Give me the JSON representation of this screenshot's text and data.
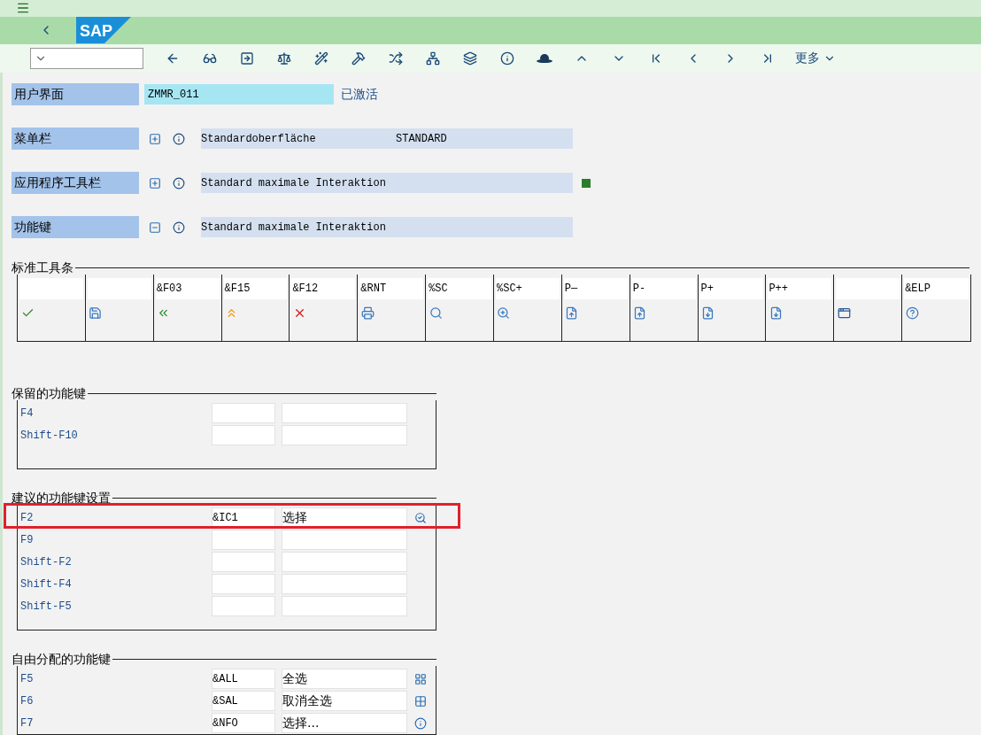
{
  "logo": "SAP",
  "toolbar": {
    "more": "更多"
  },
  "header_rows": [
    {
      "kind": "interface",
      "label": "用户界面",
      "value": "ZMMR_011",
      "status": "已激活"
    },
    {
      "kind": "element",
      "label": "菜单栏",
      "description": "Standardoberfläche",
      "code": "STANDARD",
      "marked": false
    },
    {
      "kind": "element",
      "label": "应用程序工具栏",
      "description": "Standard maximale Interaktion",
      "marked": true
    },
    {
      "kind": "element",
      "label": "功能键",
      "description": "Standard maximale Interaktion",
      "marked": false
    }
  ],
  "standard_toolbar": {
    "title": "标准工具条",
    "cells": [
      {
        "kind": "check"
      },
      {
        "kind": "save"
      },
      {
        "code": "&F03",
        "kind": "back"
      },
      {
        "code": "&F15",
        "kind": "exit"
      },
      {
        "code": "&F12",
        "kind": "cancel"
      },
      {
        "code": "&RNT",
        "kind": "print"
      },
      {
        "code": "%SC",
        "kind": "find"
      },
      {
        "code": "%SC+",
        "kind": "find-next"
      },
      {
        "code": "P—",
        "kind": "first-page"
      },
      {
        "code": "P-",
        "kind": "prev-page"
      },
      {
        "code": "P+",
        "kind": "next-page"
      },
      {
        "code": "P++",
        "kind": "last-page"
      },
      {
        "kind": "bookmark"
      },
      {
        "code": "&ELP",
        "kind": "help"
      }
    ]
  },
  "key_groups": [
    {
      "title": "保留的功能键",
      "rows": [
        {
          "key": "F4",
          "highlighted": false
        },
        {
          "key": "Shift-F10",
          "highlighted": false
        }
      ]
    },
    {
      "title": "建议的功能键设置",
      "rows": [
        {
          "key": "F2",
          "code": "&IC1",
          "text": "选择",
          "kind": "choose",
          "highlighted": true
        },
        {
          "key": "F9",
          "highlighted": false
        },
        {
          "key": "Shift-F2",
          "highlighted": false
        },
        {
          "key": "Shift-F4",
          "highlighted": false
        },
        {
          "key": "Shift-F5",
          "highlighted": false
        }
      ]
    },
    {
      "title": "自由分配的功能键",
      "rows": [
        {
          "key": "F5",
          "code": "&ALL",
          "text": "全选",
          "kind": "select-all",
          "highlighted": false
        },
        {
          "key": "F6",
          "code": "&SAL",
          "text": "取消全选",
          "kind": "deselect-all",
          "highlighted": false
        },
        {
          "key": "F7",
          "code": "&NFO",
          "text": "选择...",
          "kind": "info",
          "highlighted": false
        }
      ]
    }
  ]
}
